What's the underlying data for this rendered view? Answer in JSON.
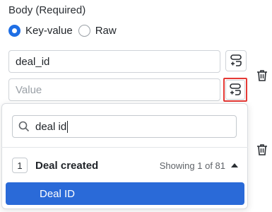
{
  "section": {
    "title": "Body (Required)"
  },
  "body_type": {
    "options": [
      {
        "label": "Key-value",
        "selected": true
      },
      {
        "label": "Raw",
        "selected": false
      }
    ]
  },
  "fields": {
    "key_value": "deal_id",
    "value_placeholder": "Value"
  },
  "dropdown": {
    "search_query": "deal id",
    "group": {
      "step_number": "1",
      "label": "Deal created",
      "showing_text": "Showing 1 of 81"
    },
    "options": [
      {
        "label": "Deal ID",
        "selected": true
      }
    ]
  },
  "colors": {
    "accent": "#1f6fe5",
    "selected_option_bg": "#2a6ad8",
    "highlight_border": "#e53935"
  },
  "icons": [
    "map-field-icon",
    "trash-icon",
    "search-icon",
    "chevron-up-icon"
  ]
}
